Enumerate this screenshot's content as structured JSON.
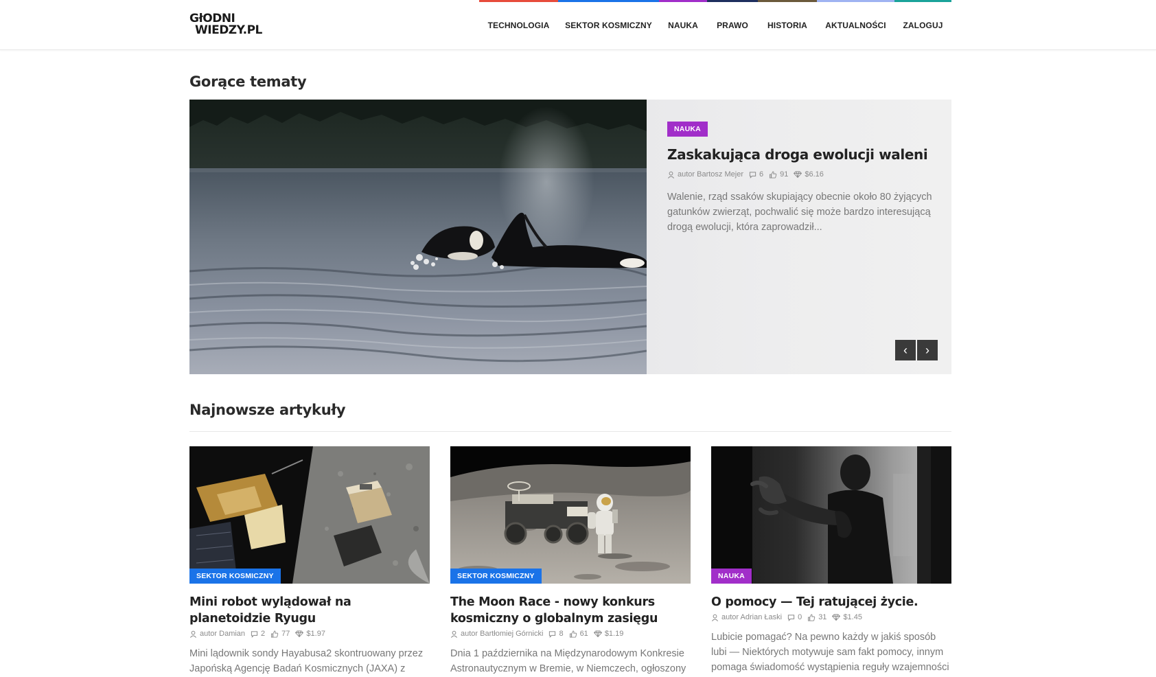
{
  "logo": {
    "line1": "GłODNI",
    "line2": "WIEDZY",
    "tld": ".PL"
  },
  "nav": [
    {
      "label": "TECHNOLOGIA",
      "color": "#e74c3c"
    },
    {
      "label": "SEKTOR KOSMICZNY",
      "color": "#1a73e8"
    },
    {
      "label": "NAUKA",
      "color": "#a12ec9"
    },
    {
      "label": "PRAWO",
      "color": "#1e2f5e"
    },
    {
      "label": "HISTORIA",
      "color": "#6b5a3c"
    },
    {
      "label": "AKTUALNOŚCI",
      "color": "#9fb3f2"
    },
    {
      "label": "ZALOGUJ",
      "color": "#1aa39a"
    }
  ],
  "hot": {
    "title": "Gorące tematy",
    "category": "NAUKA",
    "category_color": "#a12ec9",
    "headline": "Zaskakująca droga ewolucji waleni",
    "author": "autor Bartosz Mejer",
    "comments": "6",
    "likes": "91",
    "value": "$6.16",
    "excerpt": "Walenie, rząd ssaków skupiający obecnie około 80 żyjących gatunków zwierząt, pochwalić się może bardzo interesującą drogą ewolucji, która zaprowadził...",
    "prev": "‹",
    "next": "›"
  },
  "latest": {
    "title": "Najnowsze artykuły",
    "articles": [
      {
        "category": "SEKTOR KOSMICZNY",
        "category_color": "#1a73e8",
        "title": "Mini robot wylądował na planetoidzie Ryugu",
        "author": "autor Damian",
        "comments": "2",
        "likes": "77",
        "value": "$1.97",
        "excerpt": "Mini lądownik sondy Hayabusa2 skontruowany przez Japońską Agencję Badań Kosmicznych (JAXA) z"
      },
      {
        "category": "SEKTOR KOSMICZNY",
        "category_color": "#1a73e8",
        "title": "The Moon Race - nowy konkurs kosmiczny o globalnym zasięgu",
        "author": "autor Bartłomiej Górnicki",
        "comments": "8",
        "likes": "61",
        "value": "$1.19",
        "excerpt": "Dnia 1 października na Międzynarodowym Konkresie Astronautycznym w Bremie, w Niemczech, ogłoszony"
      },
      {
        "category": "NAUKA",
        "category_color": "#a12ec9",
        "title": "O pomocy — Tej ratującej życie.",
        "author": "autor Adrian Łaski",
        "comments": "0",
        "likes": "31",
        "value": "$1.45",
        "excerpt": "Lubicie pomagać? Na pewno każdy w jakiś sposób lubi — Niektórych motywuje sam fakt pomocy, innym pomaga świadomość wystąpienia reguły wzajemności"
      }
    ]
  }
}
